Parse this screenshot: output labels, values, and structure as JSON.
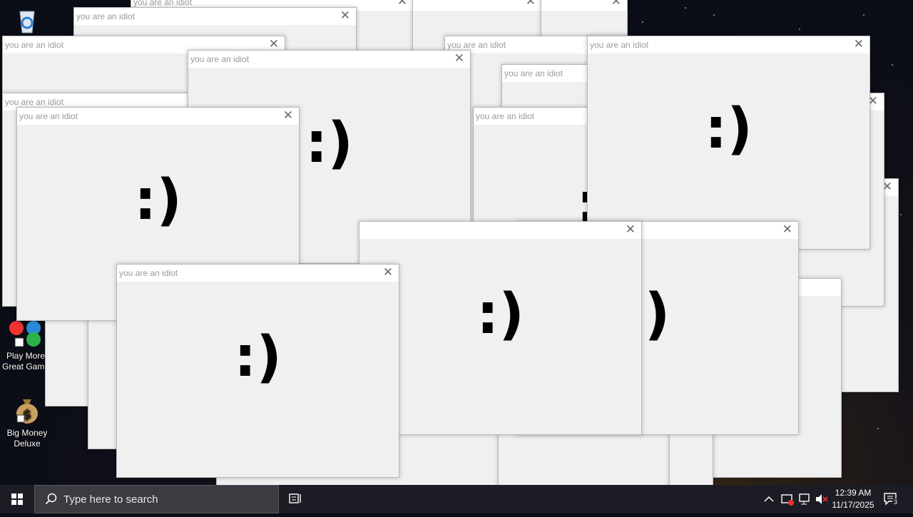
{
  "desktop_icons": [
    {
      "name": "recycle-bin",
      "label": ""
    },
    {
      "name": "play-more-great-games",
      "label": "Play More\nGreat Game"
    },
    {
      "name": "big-money-deluxe",
      "label": "Big Money\nDeluxe"
    }
  ],
  "popup": {
    "title": "you are an idiot",
    "close_glyph": "✕",
    "face": ":)",
    "face_partial": ")"
  },
  "taskbar": {
    "search_placeholder": "Type here to search",
    "time": "12:39 AM",
    "date": "11/17/2025",
    "notification_count": "3"
  },
  "colors": {
    "window_bg": "#f0f0f0",
    "titlebar_bg": "#ffffff",
    "taskbar_bg": "#1c1d24",
    "search_bg": "#3b3c42"
  }
}
